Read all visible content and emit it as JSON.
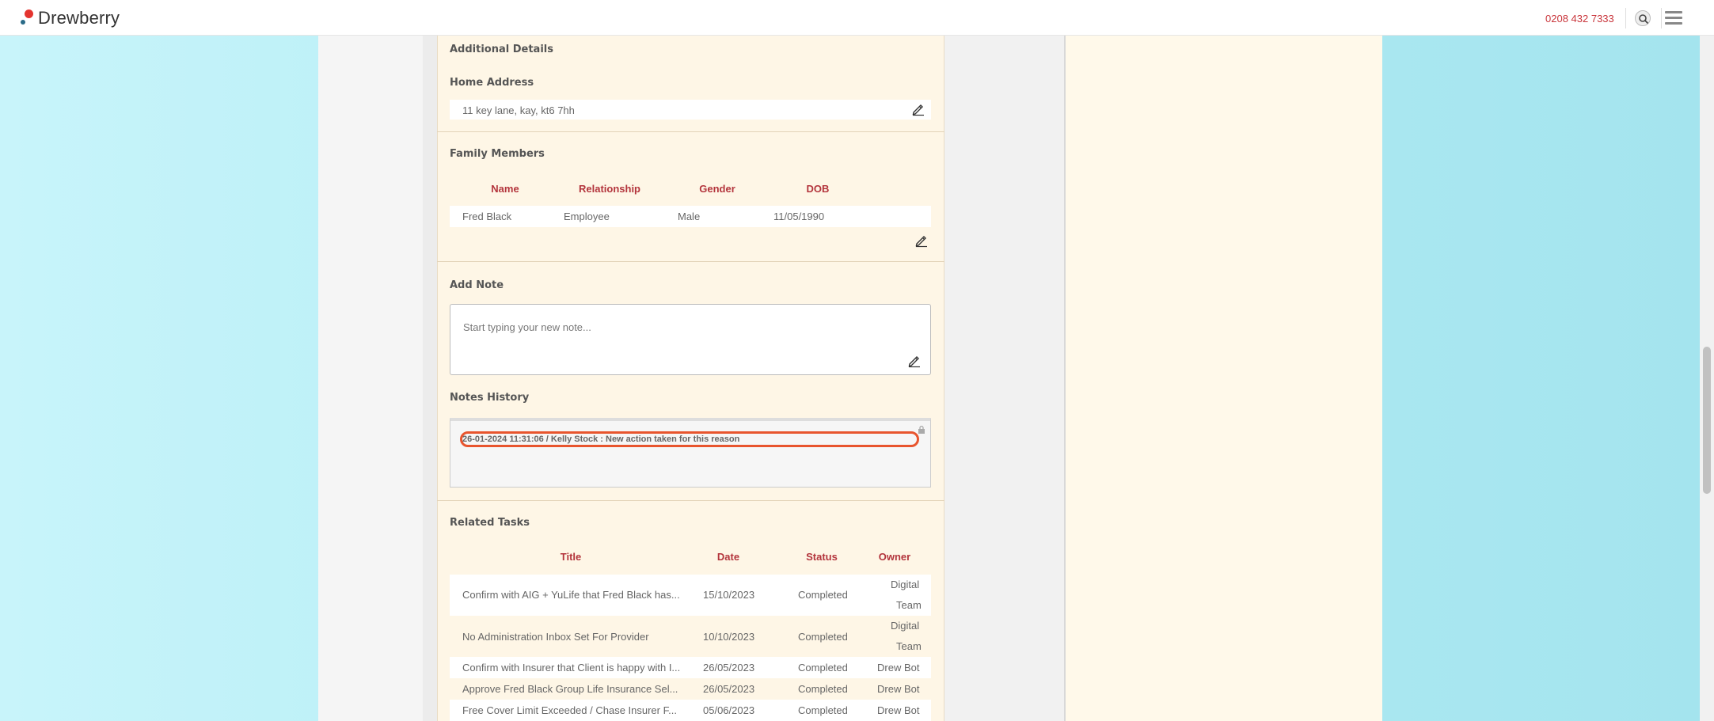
{
  "header": {
    "logo_text": "Drewberry",
    "phone": "0208 432 7333"
  },
  "additional_details": {
    "title": "Additional Details",
    "home_address_label": "Home Address",
    "home_address_value": "11 key lane, kay, kt6 7hh"
  },
  "family": {
    "title": "Family Members",
    "columns": [
      "Name",
      "Relationship",
      "Gender",
      "DOB"
    ],
    "rows": [
      {
        "name": "Fred Black",
        "relationship": "Employee",
        "gender": "Male",
        "dob": "11/05/1990"
      }
    ]
  },
  "add_note": {
    "title": "Add Note",
    "placeholder": "Start typing your new note..."
  },
  "notes_history": {
    "title": "Notes History",
    "entries": [
      "26-01-2024 11:31:06 / Kelly Stock : New action taken for this reason"
    ]
  },
  "related_tasks": {
    "title": "Related Tasks",
    "columns": [
      "Title",
      "Date",
      "Status",
      "Owner"
    ],
    "rows": [
      {
        "title": "Confirm with AIG + YuLife that Fred Black has...",
        "date": "15/10/2023",
        "status": "Completed",
        "owner1": "Digital",
        "owner2": "Team"
      },
      {
        "title": "No Administration Inbox Set For Provider",
        "date": "10/10/2023",
        "status": "Completed",
        "owner1": "Digital",
        "owner2": "Team"
      },
      {
        "title": "Confirm with Insurer that Client is happy with I...",
        "date": "26/05/2023",
        "status": "Completed",
        "owner1": "Drew Bot",
        "owner2": ""
      },
      {
        "title": "Approve Fred Black Group Life Insurance Sel...",
        "date": "26/05/2023",
        "status": "Completed",
        "owner1": "Drew Bot",
        "owner2": ""
      },
      {
        "title": "Free Cover Limit Exceeded / Chase Insurer F...",
        "date": "05/06/2023",
        "status": "Completed",
        "owner1": "Drew Bot",
        "owner2": ""
      }
    ]
  },
  "colors": {
    "accent": "#b3343c",
    "highlight_ring": "#e8552e",
    "content_bg": "#fef6e6"
  }
}
